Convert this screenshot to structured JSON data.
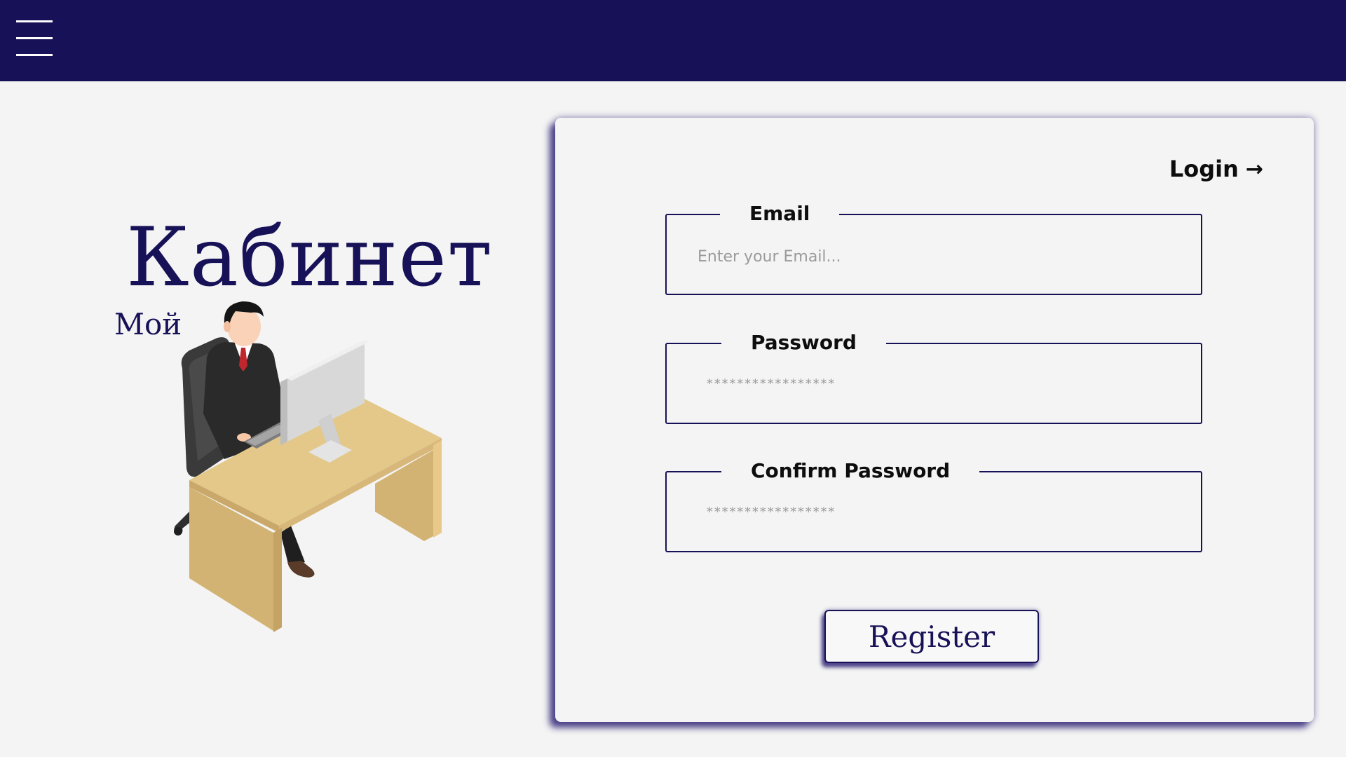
{
  "header": {
    "menu_icon": "hamburger-menu-icon",
    "background_color": "#171157"
  },
  "brand": {
    "title": "Кабинет",
    "subtitle": "Мой",
    "color": "#171157"
  },
  "illustration": {
    "icon": "office-worker-at-desk-illustration"
  },
  "form": {
    "login_label": "Login",
    "login_icon": "arrow-right-icon",
    "email": {
      "label": "Email",
      "placeholder": "Enter your Email..."
    },
    "password": {
      "label": "Password",
      "mask": "*****************"
    },
    "confirm_password": {
      "label": "Confirm Password",
      "mask": "*****************"
    },
    "register_label": "Register"
  }
}
